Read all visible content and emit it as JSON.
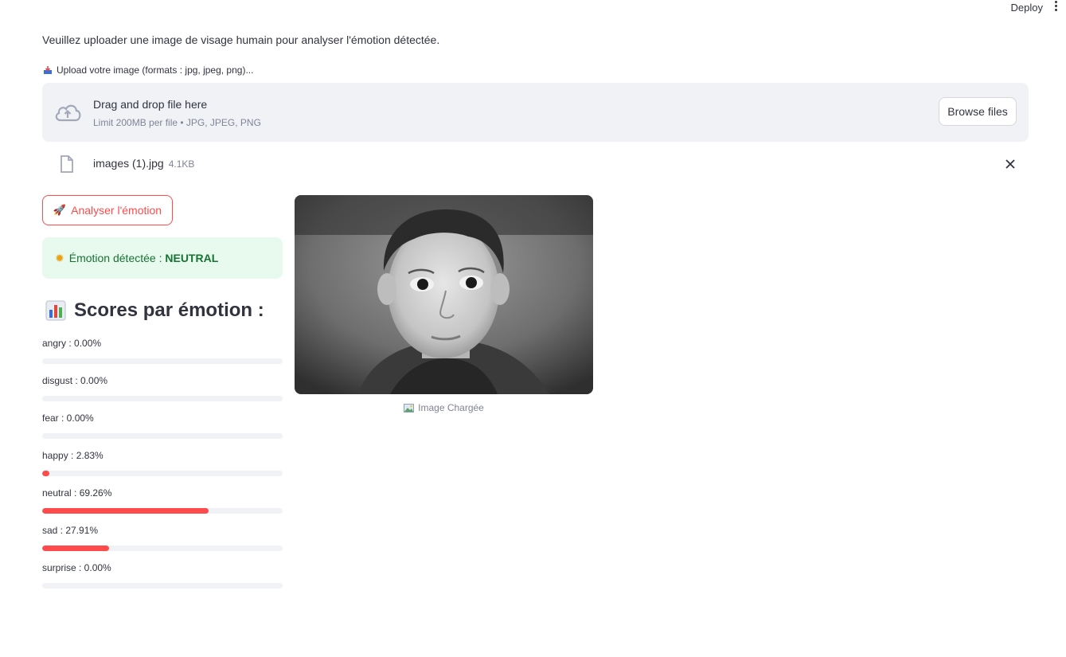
{
  "topbar": {
    "deploy_label": "Deploy",
    "menu_icon": "more-vertical-icon"
  },
  "intro_text": "Veuillez uploader une image de visage humain pour analyser l'émotion détectée.",
  "uploader": {
    "label": "Upload votre image (formats : jpg, jpeg, png)...",
    "label_icon": "inbox-tray-icon",
    "drop_title": "Drag and drop file here",
    "drop_limit": "Limit 200MB per file • JPG, JPEG, PNG",
    "browse_label": "Browse files",
    "file_name": "images (1).jpg",
    "file_size": "4.1KB"
  },
  "analyze_button": {
    "label": "Analyser l'émotion",
    "icon": "rocket-icon"
  },
  "result": {
    "prefix": "Émotion détectée : ",
    "emotion": "NEUTRAL",
    "icon": "sun-icon"
  },
  "scores": {
    "title": "Scores par émotion :",
    "icon": "bar-chart-icon",
    "items": [
      {
        "label": "angry : 0.00%",
        "value": 0.0
      },
      {
        "label": "disgust : 0.00%",
        "value": 0.0
      },
      {
        "label": "fear : 0.00%",
        "value": 0.0
      },
      {
        "label": "happy : 2.83%",
        "value": 2.83
      },
      {
        "label": "neutral : 69.26%",
        "value": 69.26
      },
      {
        "label": "sad : 27.91%",
        "value": 27.91
      },
      {
        "label": "surprise : 0.00%",
        "value": 0.0
      }
    ]
  },
  "image": {
    "caption": "Image Chargée",
    "caption_icon": "framed-picture-icon"
  },
  "colors": {
    "accent": "#ff4b4b",
    "success_bg": "#e8f9ee",
    "success_text": "#177233",
    "dropzone_bg": "#f0f2f6"
  }
}
